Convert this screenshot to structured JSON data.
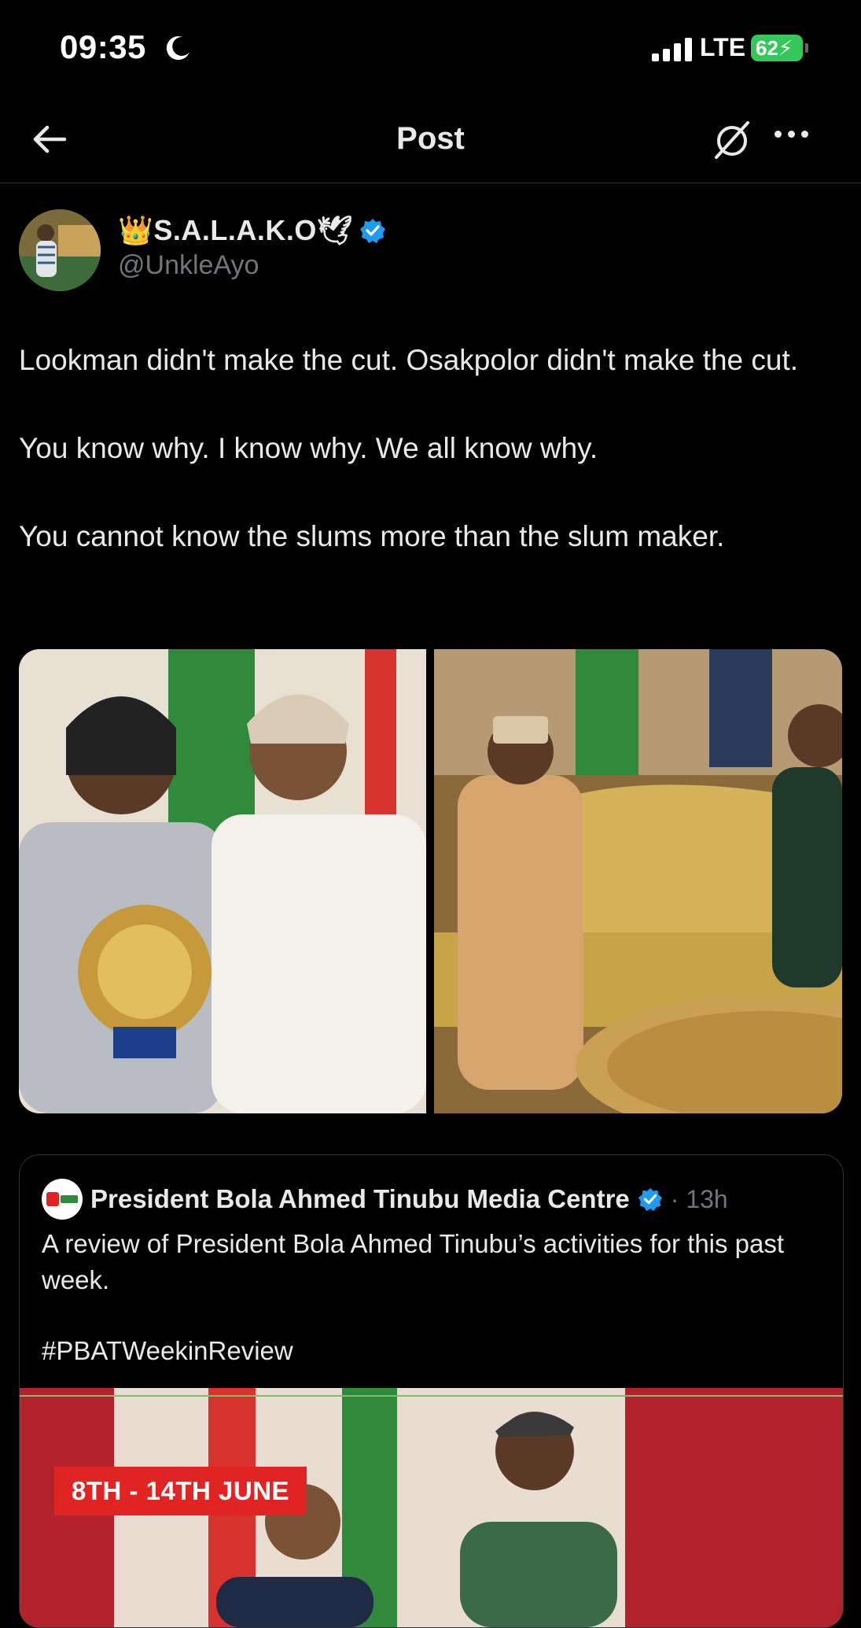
{
  "status_bar": {
    "time": "09:35",
    "network": "LTE",
    "battery": "62"
  },
  "nav": {
    "title": "Post"
  },
  "author": {
    "display_name": "👑S.A.L.A.K.O🕊",
    "handle": "@UnkleAyo"
  },
  "tweet": {
    "paragraphs": [
      "Lookman didn't make the cut. Osakpolor didn't make the cut.",
      "You know why. I know why. We all know why.",
      "You cannot know the slums more than the slum maker."
    ]
  },
  "quote": {
    "name": "President Bola Ahmed Tinubu Media Centre",
    "time": "· 13h",
    "text": "A review of President Bola Ahmed Tinubu’s activities for this past week.",
    "hashtag": "#PBATWeekinReview",
    "banner": "8TH - 14TH JUNE"
  },
  "colors": {
    "verified": "#1d9bf0",
    "battery": "#34c759",
    "banner": "#e02424"
  },
  "icons": [
    "moon-icon",
    "back-arrow-icon",
    "grok-icon",
    "more-icon",
    "verified-badge-icon"
  ]
}
